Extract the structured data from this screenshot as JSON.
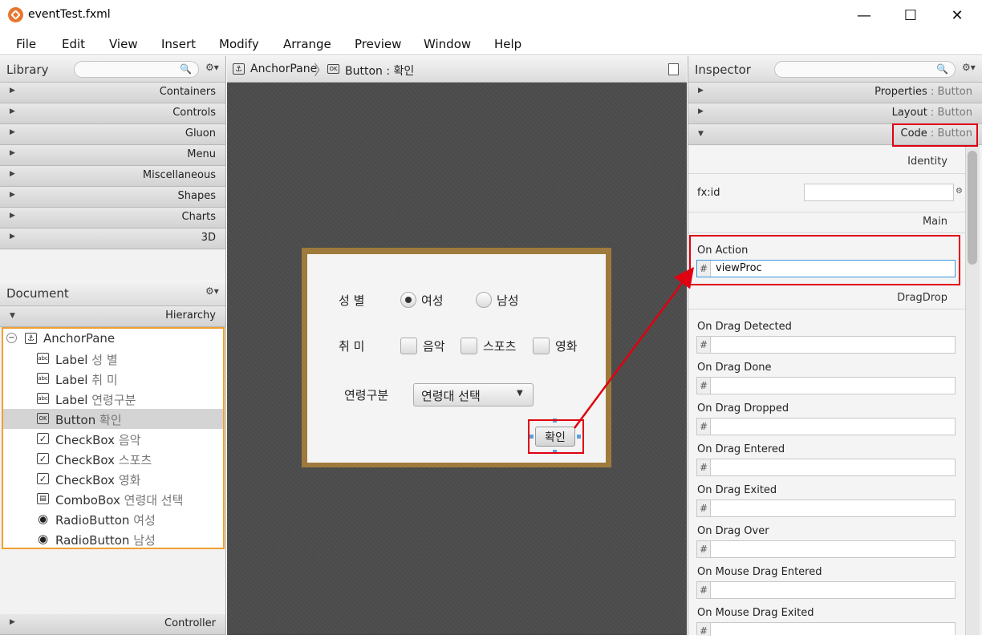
{
  "window": {
    "title": "eventTest.fxml",
    "minimize": "—",
    "maximize": "☐",
    "close": "✕"
  },
  "menu": [
    "File",
    "Edit",
    "View",
    "Insert",
    "Modify",
    "Arrange",
    "Preview",
    "Window",
    "Help"
  ],
  "library": {
    "title": "Library",
    "sections": [
      "Containers",
      "Controls",
      "Gluon",
      "Menu",
      "Miscellaneous",
      "Shapes",
      "Charts",
      "3D"
    ]
  },
  "document": {
    "title": "Document",
    "hierarchy_label": "Hierarchy",
    "root": "AnchorPane",
    "items": [
      {
        "type": "Label",
        "text": "성 별",
        "icon": "label-icon"
      },
      {
        "type": "Label",
        "text": "취 미",
        "icon": "label-icon"
      },
      {
        "type": "Label",
        "text": "연령구분",
        "icon": "label-icon"
      },
      {
        "type": "Button",
        "text": "확인",
        "icon": "button-icon"
      },
      {
        "type": "CheckBox",
        "text": "음악",
        "icon": "checkbox-icon"
      },
      {
        "type": "CheckBox",
        "text": "스포츠",
        "icon": "checkbox-icon"
      },
      {
        "type": "CheckBox",
        "text": "영화",
        "icon": "checkbox-icon"
      },
      {
        "type": "ComboBox",
        "text": "연령대 선택",
        "icon": "combobox-icon"
      },
      {
        "type": "RadioButton",
        "text": "여성",
        "icon": "radio-icon"
      },
      {
        "type": "RadioButton",
        "text": "남성",
        "icon": "radio-icon"
      }
    ],
    "controller_label": "Controller"
  },
  "breadcrumb": {
    "root": "AnchorPane",
    "current_type": "Button",
    "current_text": "확인",
    "separator": " : "
  },
  "form": {
    "gender_label": "성  별",
    "female": "여성",
    "male": "남성",
    "hobby_label": "취  미",
    "music": "음악",
    "sports": "스포츠",
    "movie": "영화",
    "age_label": "연령구분",
    "age_combo": "연령대 선택",
    "confirm": "확인"
  },
  "inspector": {
    "title": "Inspector",
    "sections": [
      {
        "name": "Properties",
        "target": "Button"
      },
      {
        "name": "Layout",
        "target": "Button"
      },
      {
        "name": "Code",
        "target": "Button"
      }
    ],
    "section_sep": " : ",
    "identity": "Identity",
    "fxid_label": "fx:id",
    "fxid_value": "",
    "main": "Main",
    "on_action_label": "On Action",
    "on_action_value": "viewProc",
    "dragdrop": "DragDrop",
    "drag_fields": [
      "On Drag Detected",
      "On Drag Done",
      "On Drag Dropped",
      "On Drag Entered",
      "On Drag Exited",
      "On Drag Over",
      "On Mouse Drag Entered",
      "On Mouse Drag Exited"
    ],
    "hash": "#"
  }
}
